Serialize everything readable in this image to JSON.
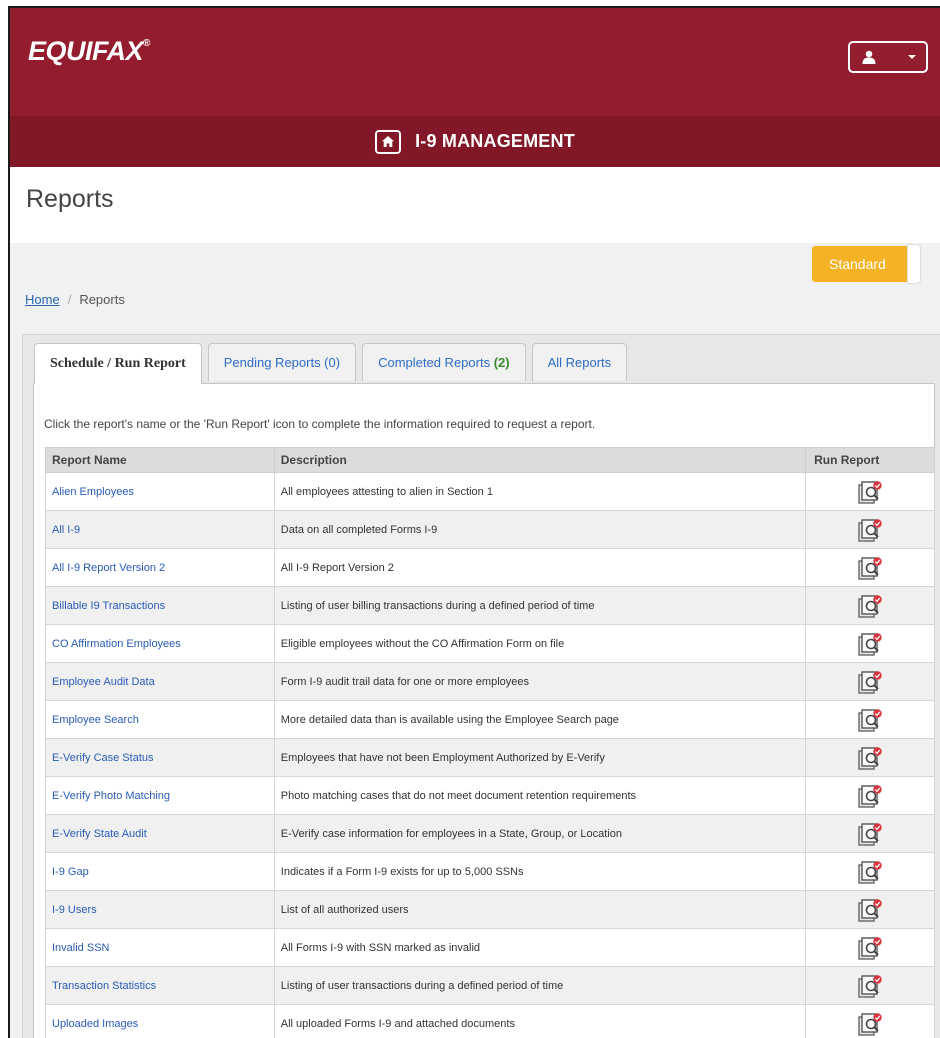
{
  "header": {
    "logo_text": "EQUIFAX",
    "logo_mark": "®",
    "app_title": "I-9 MANAGEMENT",
    "brand_color": "#941c2f"
  },
  "page": {
    "title": "Reports",
    "mode_button": "Standard"
  },
  "breadcrumb": {
    "home": "Home",
    "separator": "/",
    "current": "Reports"
  },
  "tabs": [
    {
      "label": "Schedule / Run Report",
      "active": true
    },
    {
      "label": "Pending Reports (0)"
    },
    {
      "label": "Completed Reports ",
      "count": "(2)"
    },
    {
      "label": "All Reports"
    }
  ],
  "instructions": "Click the report's name or the 'Run Report' icon to complete the information required to request a report.",
  "table": {
    "columns": [
      "Report Name",
      "Description",
      "Run Report"
    ],
    "rows": [
      {
        "name": "Alien Employees",
        "desc": "All employees attesting to alien in Section 1"
      },
      {
        "name": "All I-9",
        "desc": "Data on all completed Forms I-9"
      },
      {
        "name": "All I-9 Report Version 2",
        "desc": "All I-9 Report Version 2"
      },
      {
        "name": "Billable I9 Transactions",
        "desc": "Listing of user billing transactions during a defined period of time"
      },
      {
        "name": "CO Affirmation Employees",
        "desc": "Eligible employees without the CO Affirmation Form on file"
      },
      {
        "name": "Employee Audit Data",
        "desc": "Form I-9 audit trail data for one or more employees"
      },
      {
        "name": "Employee Search",
        "desc": "More detailed data than is available using the Employee Search page"
      },
      {
        "name": "E-Verify Case Status",
        "desc": "Employees that have not been Employment Authorized by E-Verify"
      },
      {
        "name": "E-Verify Photo Matching",
        "desc": "Photo matching cases that do not meet document retention requirements"
      },
      {
        "name": "E-Verify State Audit",
        "desc": "E-Verify case information for employees in a State, Group, or Location"
      },
      {
        "name": "I-9 Gap",
        "desc": "Indicates if a Form I-9 exists for up to 5,000 SSNs"
      },
      {
        "name": "I-9 Users",
        "desc": "List of all authorized users"
      },
      {
        "name": "Invalid SSN",
        "desc": "All Forms I-9 with SSN marked as invalid"
      },
      {
        "name": "Transaction Statistics",
        "desc": "Listing of user transactions during a defined period of time"
      },
      {
        "name": "Uploaded Images",
        "desc": "All uploaded Forms I-9 and attached documents"
      }
    ]
  }
}
